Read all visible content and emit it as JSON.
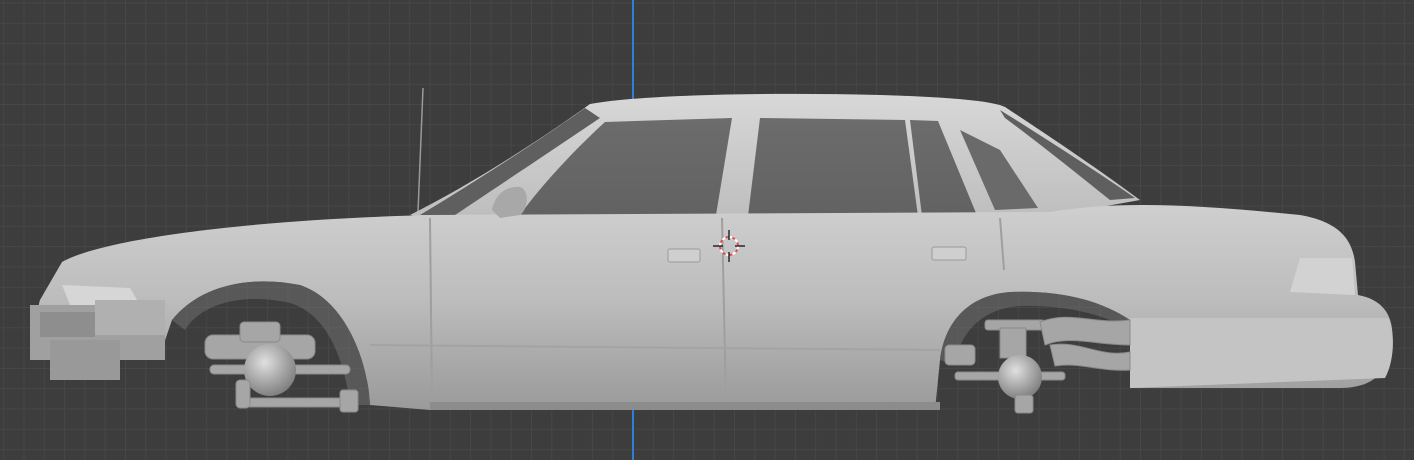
{
  "viewport": {
    "mode": "orthographic-side-view",
    "object": "sedan-car-body",
    "shading": "solid",
    "background_color": "#3d3d3d",
    "grid_minor_color": "#474747",
    "grid_major_color": "#575757",
    "axis_z_color": "#2f7fd8",
    "model_color": "#b8b8b8",
    "glass_color": "#6a6a6a",
    "cursor_color": "#e05050"
  }
}
